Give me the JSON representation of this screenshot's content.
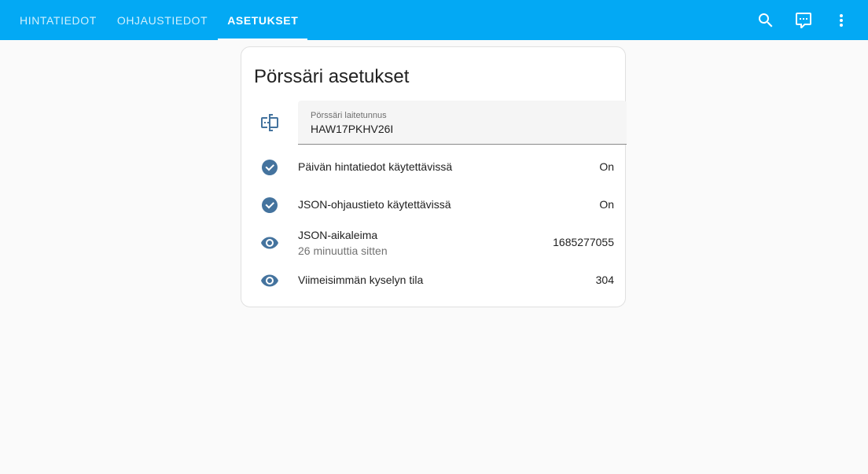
{
  "tabs": [
    {
      "label": "Hintatiedot",
      "active": false
    },
    {
      "label": "Ohjaustiedot",
      "active": false
    },
    {
      "label": "Asetukset",
      "active": true
    }
  ],
  "toolbar": {
    "icons": [
      "search-icon",
      "assist-chat-icon",
      "overflow-menu-icon"
    ]
  },
  "card": {
    "title": "Pörssäri asetukset",
    "device_field": {
      "icon": "device-id-icon",
      "label": "Pörssäri laitetunnus",
      "value": "HAW17PKHV26I"
    },
    "rows": [
      {
        "icon": "check-circle-icon",
        "label": "Päivän hintatiedot käytettävissä",
        "secondary": "",
        "value": "On"
      },
      {
        "icon": "check-circle-icon",
        "label": "JSON-ohjaustieto käytettävissä",
        "secondary": "",
        "value": "On"
      },
      {
        "icon": "eye-icon",
        "label": "JSON-aikaleima",
        "secondary": "26 minuuttia sitten",
        "value": "1685277055"
      },
      {
        "icon": "eye-icon",
        "label": "Viimeisimmän kyselyn tila",
        "secondary": "",
        "value": "304"
      }
    ]
  },
  "colors": {
    "appbar": "#03a9f4",
    "icon": "#44739e",
    "background": "#fafafa"
  }
}
